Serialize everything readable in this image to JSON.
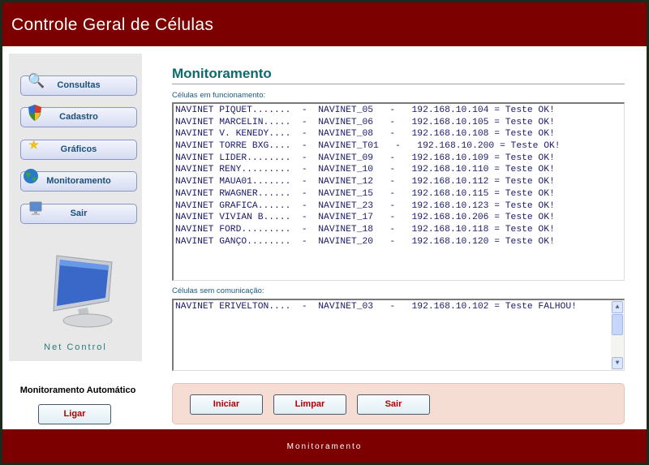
{
  "header": {
    "title": "Controle Geral de Células"
  },
  "sidebar": {
    "items": [
      {
        "label": "Consultas",
        "icon": "magnifier-icon"
      },
      {
        "label": "Cadastro",
        "icon": "shield-icon"
      },
      {
        "label": "Gráficos",
        "icon": "star-hand-icon"
      },
      {
        "label": "Monitoramento",
        "icon": "globe-icon"
      },
      {
        "label": "Sair",
        "icon": "computer-icon"
      }
    ],
    "brand": "Net Control",
    "auto_label": "Monitoramento Automático",
    "ligar": "Ligar"
  },
  "main": {
    "title": "Monitoramento",
    "working_label": "Células em funcionamento:",
    "working": [
      "NAVINET PIQUET.......  -  NAVINET_05   -   192.168.10.104 = Teste OK!",
      "NAVINET MARCELIN.....  -  NAVINET_06   -   192.168.10.105 = Teste OK!",
      "NAVINET V. KENEDY....  -  NAVINET_08   -   192.168.10.108 = Teste OK!",
      "NAVINET TORRE BXG....  -  NAVINET_T01   -   192.168.10.200 = Teste OK!",
      "NAVINET LIDER........  -  NAVINET_09   -   192.168.10.109 = Teste OK!",
      "NAVINET RENY.........  -  NAVINET_10   -   192.168.10.110 = Teste OK!",
      "NAVINET MAUA01.......  -  NAVINET_12   -   192.168.10.112 = Teste OK!",
      "NAVINET RWAGNER......  -  NAVINET_15   -   192.168.10.115 = Teste OK!",
      "NAVINET GRAFICA......  -  NAVINET_23   -   192.168.10.123 = Teste OK!",
      "NAVINET VIVIAN B.....  -  NAVINET_17   -   192.168.10.206 = Teste OK!",
      "NAVINET FORD.........  -  NAVINET_18   -   192.168.10.118 = Teste OK!",
      "NAVINET GANÇO........  -  NAVINET_20   -   192.168.10.120 = Teste OK!"
    ],
    "failed_label": "Células sem comunicação:",
    "failed": [
      "NAVINET ERIVELTON....  -  NAVINET_03   -   192.168.10.102 = Teste FALHOU!"
    ],
    "buttons": {
      "start": "Iniciar",
      "clear": "Limpar",
      "exit": "Sair"
    }
  },
  "footer": {
    "text": "Monitoramento"
  }
}
